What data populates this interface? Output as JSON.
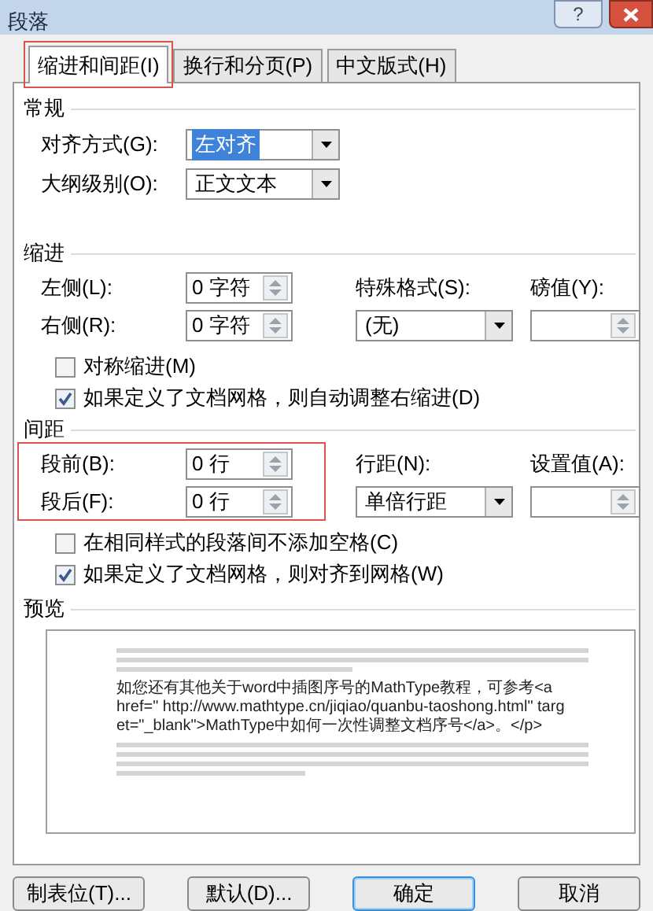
{
  "window": {
    "title": "段落",
    "help_button": "?"
  },
  "tabs": [
    {
      "label": "缩进和间距(I)",
      "selected": true,
      "highlighted": true
    },
    {
      "label": "换行和分页(P)",
      "selected": false,
      "highlighted": false
    },
    {
      "label": "中文版式(H)",
      "selected": false,
      "highlighted": false
    }
  ],
  "general": {
    "heading": "常规",
    "fields": [
      {
        "label": "对齐方式(G):",
        "value": "左对齐",
        "value_selected": true
      },
      {
        "label": "大纲级别(O):",
        "value": "正文文本",
        "value_selected": false
      }
    ]
  },
  "indent": {
    "heading": "缩进",
    "left": {
      "label": "左侧(L):",
      "value": "0 字符"
    },
    "right": {
      "label": "右侧(R):",
      "value": "0 字符"
    },
    "special": {
      "label": "特殊格式(S):",
      "value": "(无)"
    },
    "by": {
      "label": "磅值(Y):"
    },
    "checkboxes": [
      {
        "label": "对称缩进(M)",
        "checked": false
      },
      {
        "label": "如果定义了文档网格，则自动调整右缩进(D)",
        "checked": true
      }
    ]
  },
  "spacing": {
    "heading": "间距",
    "highlighted": true,
    "before": {
      "label": "段前(B):",
      "value": "0 行"
    },
    "after": {
      "label": "段后(F):",
      "value": "0 行"
    },
    "line_spacing": {
      "label": "行距(N):",
      "value": "单倍行距"
    },
    "at": {
      "label": "设置值(A):"
    },
    "checkboxes": [
      {
        "label": "在相同样式的段落间不添加空格(C)",
        "checked": false
      },
      {
        "label": "如果定义了文档网格，则对齐到网格(W)",
        "checked": true
      }
    ]
  },
  "preview": {
    "heading": "预览",
    "text": "如您还有其他关于word中插图序号的MathType教程，可参考<a href=\" http://www.mathtype.cn/jiqiao/quanbu-taoshong.html\" target=\"_blank\">MathType中如何一次性调整文档序号</a>。</p>"
  },
  "buttons": [
    {
      "label": "制表位(T)...",
      "default": false
    },
    {
      "label": "默认(D)...",
      "default": false
    },
    {
      "label": "确定",
      "default": true
    },
    {
      "label": "取消",
      "default": false
    }
  ]
}
